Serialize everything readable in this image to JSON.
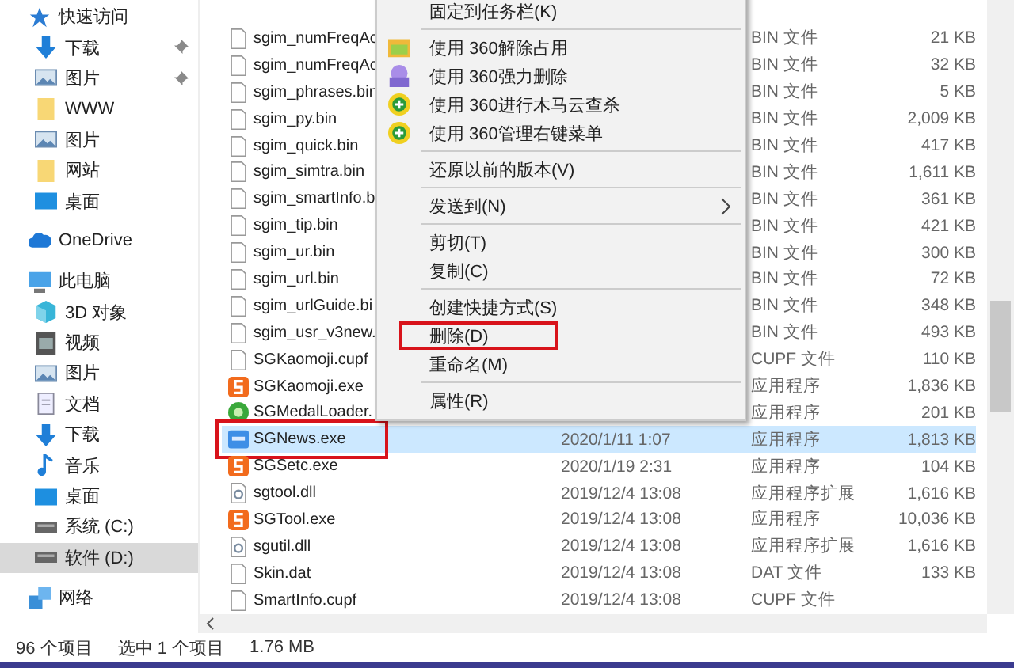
{
  "sidebar": {
    "items": [
      {
        "label": "快速访问",
        "children": [
          {
            "label": "下载",
            "pinned": true
          },
          {
            "label": "图片",
            "pinned": true
          },
          {
            "label": "WWW",
            "pinned": false
          },
          {
            "label": "图片",
            "pinned": false
          },
          {
            "label": "网站",
            "pinned": false
          },
          {
            "label": "桌面",
            "pinned": false
          }
        ]
      },
      {
        "label": "OneDrive"
      },
      {
        "label": "此电脑",
        "children": [
          {
            "label": "3D 对象",
            "selected": false
          },
          {
            "label": "视频",
            "selected": false
          },
          {
            "label": "图片",
            "selected": false
          },
          {
            "label": "文档",
            "selected": false
          },
          {
            "label": "下载",
            "selected": false
          },
          {
            "label": "音乐",
            "selected": false
          },
          {
            "label": "桌面",
            "selected": false
          },
          {
            "label": "系统 (C:)",
            "selected": false
          },
          {
            "label": "软件 (D:)",
            "selected": true
          }
        ]
      },
      {
        "label": "网络"
      }
    ]
  },
  "files": {
    "rows": [
      {
        "name": "sgim_numFreqAc",
        "kind": "file",
        "type": "BIN 文件",
        "size": "21 KB",
        "selected": false,
        "boxed": false
      },
      {
        "name": "sgim_numFreqAc",
        "kind": "file",
        "type": "BIN 文件",
        "size": "32 KB",
        "selected": false,
        "boxed": false
      },
      {
        "name": "sgim_phrases.bin",
        "kind": "file",
        "type": "BIN 文件",
        "size": "5 KB",
        "selected": false,
        "boxed": false
      },
      {
        "name": "sgim_py.bin",
        "kind": "file",
        "type": "BIN 文件",
        "size": "2,009 KB",
        "selected": false,
        "boxed": false
      },
      {
        "name": "sgim_quick.bin",
        "kind": "file",
        "type": "BIN 文件",
        "size": "417 KB",
        "selected": false,
        "boxed": false
      },
      {
        "name": "sgim_simtra.bin",
        "kind": "file",
        "type": "BIN 文件",
        "size": "1,611 KB",
        "selected": false,
        "boxed": false
      },
      {
        "name": "sgim_smartInfo.b",
        "kind": "file",
        "type": "BIN 文件",
        "size": "361 KB",
        "selected": false,
        "boxed": false
      },
      {
        "name": "sgim_tip.bin",
        "kind": "file",
        "type": "BIN 文件",
        "size": "421 KB",
        "selected": false,
        "boxed": false
      },
      {
        "name": "sgim_ur.bin",
        "kind": "file",
        "type": "BIN 文件",
        "size": "300 KB",
        "selected": false,
        "boxed": false
      },
      {
        "name": "sgim_url.bin",
        "kind": "file",
        "type": "BIN 文件",
        "size": "72 KB",
        "selected": false,
        "boxed": false
      },
      {
        "name": "sgim_urlGuide.bi",
        "kind": "file",
        "type": "BIN 文件",
        "size": "348 KB",
        "selected": false,
        "boxed": false
      },
      {
        "name": "sgim_usr_v3new.",
        "kind": "file",
        "type": "BIN 文件",
        "size": "493 KB",
        "selected": false,
        "boxed": false
      },
      {
        "name": "SGKaomoji.cupf",
        "kind": "file",
        "type": "CUPF 文件",
        "size": "110 KB",
        "selected": false,
        "boxed": false
      },
      {
        "name": "SGKaomoji.exe",
        "kind": "app",
        "type": "应用程序",
        "size": "1,836 KB",
        "selected": false,
        "boxed": false
      },
      {
        "name": "SGMedalLoader.",
        "kind": "medal",
        "type": "应用程序",
        "size": "201 KB",
        "selected": false,
        "boxed": false
      },
      {
        "name": "SGNews.exe",
        "kind": "news",
        "date": "2020/1/11 1:07",
        "type": "应用程序",
        "size": "1,813 KB",
        "selected": true,
        "boxed": true
      },
      {
        "name": "SGSetc.exe",
        "kind": "app",
        "date": "2020/1/19 2:31",
        "type": "应用程序",
        "size": "104 KB",
        "selected": false,
        "boxed": false
      },
      {
        "name": "sgtool.dll",
        "kind": "library",
        "date": "2019/12/4 13:08",
        "type": "应用程序扩展",
        "size": "1,616 KB",
        "selected": false,
        "boxed": false
      },
      {
        "name": "SGTool.exe",
        "kind": "app",
        "date": "2019/12/4 13:08",
        "type": "应用程序",
        "size": "10,036 KB",
        "selected": false,
        "boxed": false
      },
      {
        "name": "sgutil.dll",
        "kind": "library",
        "date": "2019/12/4 13:08",
        "type": "应用程序扩展",
        "size": "1,616 KB",
        "selected": false,
        "boxed": false
      },
      {
        "name": "Skin.dat",
        "kind": "file",
        "date": "2019/12/4 13:08",
        "type": "DAT 文件",
        "size": "133 KB",
        "selected": false,
        "boxed": false
      },
      {
        "name": "SmartInfo.cupf",
        "kind": "file",
        "date": "2019/12/4 13:08",
        "type": "CUPF 文件",
        "selected": false,
        "boxed": false
      }
    ]
  },
  "context_menu": {
    "items": [
      {
        "kind": "item",
        "label": "固定到任务栏(K)",
        "boxed": false
      },
      {
        "kind": "separator"
      },
      {
        "kind": "item",
        "label": "使用 360解除占用",
        "boxed": false
      },
      {
        "kind": "item",
        "label": "使用 360强力删除",
        "boxed": false
      },
      {
        "kind": "item",
        "label": "使用 360进行木马云查杀",
        "boxed": false
      },
      {
        "kind": "item",
        "label": "使用 360管理右键菜单",
        "boxed": false
      },
      {
        "kind": "separator"
      },
      {
        "kind": "item",
        "label": "还原以前的版本(V)",
        "boxed": false
      },
      {
        "kind": "separator"
      },
      {
        "kind": "item",
        "label": "发送到(N)",
        "submenu": true,
        "boxed": false
      },
      {
        "kind": "separator"
      },
      {
        "kind": "item",
        "label": "剪切(T)",
        "boxed": false
      },
      {
        "kind": "item",
        "label": "复制(C)",
        "boxed": false
      },
      {
        "kind": "separator"
      },
      {
        "kind": "item",
        "label": "创建快捷方式(S)",
        "boxed": false
      },
      {
        "kind": "item",
        "label": "删除(D)",
        "boxed": true
      },
      {
        "kind": "item",
        "label": "重命名(M)",
        "boxed": false
      },
      {
        "kind": "separator"
      },
      {
        "kind": "item",
        "label": "属性(R)",
        "boxed": false
      }
    ]
  },
  "status_bar": {
    "item_count": "96 个项目",
    "selection": "选中 1 个项目",
    "selection_size": "1.76 MB"
  }
}
